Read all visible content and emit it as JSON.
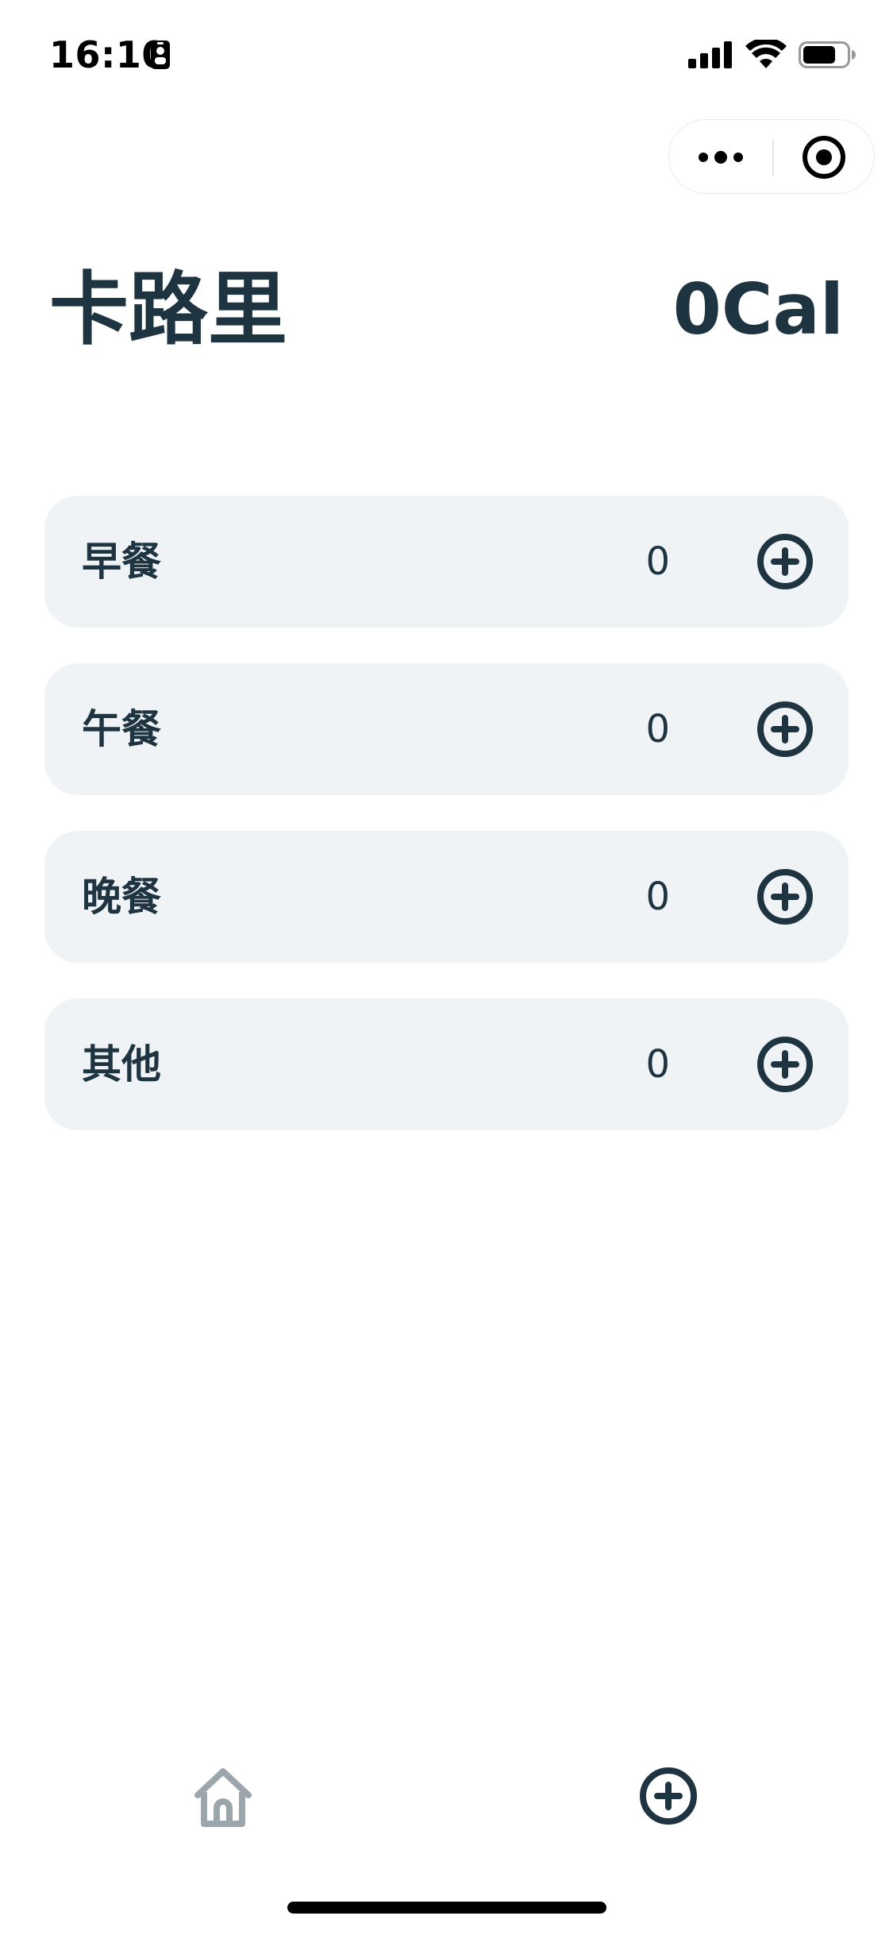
{
  "status_bar": {
    "time": "16:10"
  },
  "header": {
    "title": "卡路里",
    "total_calories": "0Cal"
  },
  "meals": [
    {
      "label": "早餐",
      "value": "0"
    },
    {
      "label": "午餐",
      "value": "0"
    },
    {
      "label": "晚餐",
      "value": "0"
    },
    {
      "label": "其他",
      "value": "0"
    }
  ],
  "icons": {
    "status": [
      "id-badge-icon",
      "signal-icon",
      "wifi-icon",
      "battery-icon"
    ],
    "capsule": [
      "more-icon",
      "close-target-icon"
    ],
    "meal_action": "plus-circle-icon",
    "tabs": [
      "home-icon",
      "plus-circle-icon"
    ]
  },
  "colors": {
    "primary_text": "#1e3441",
    "card_background": "#f0f3f5",
    "inactive_tab_icon": "#9aa5ac"
  }
}
